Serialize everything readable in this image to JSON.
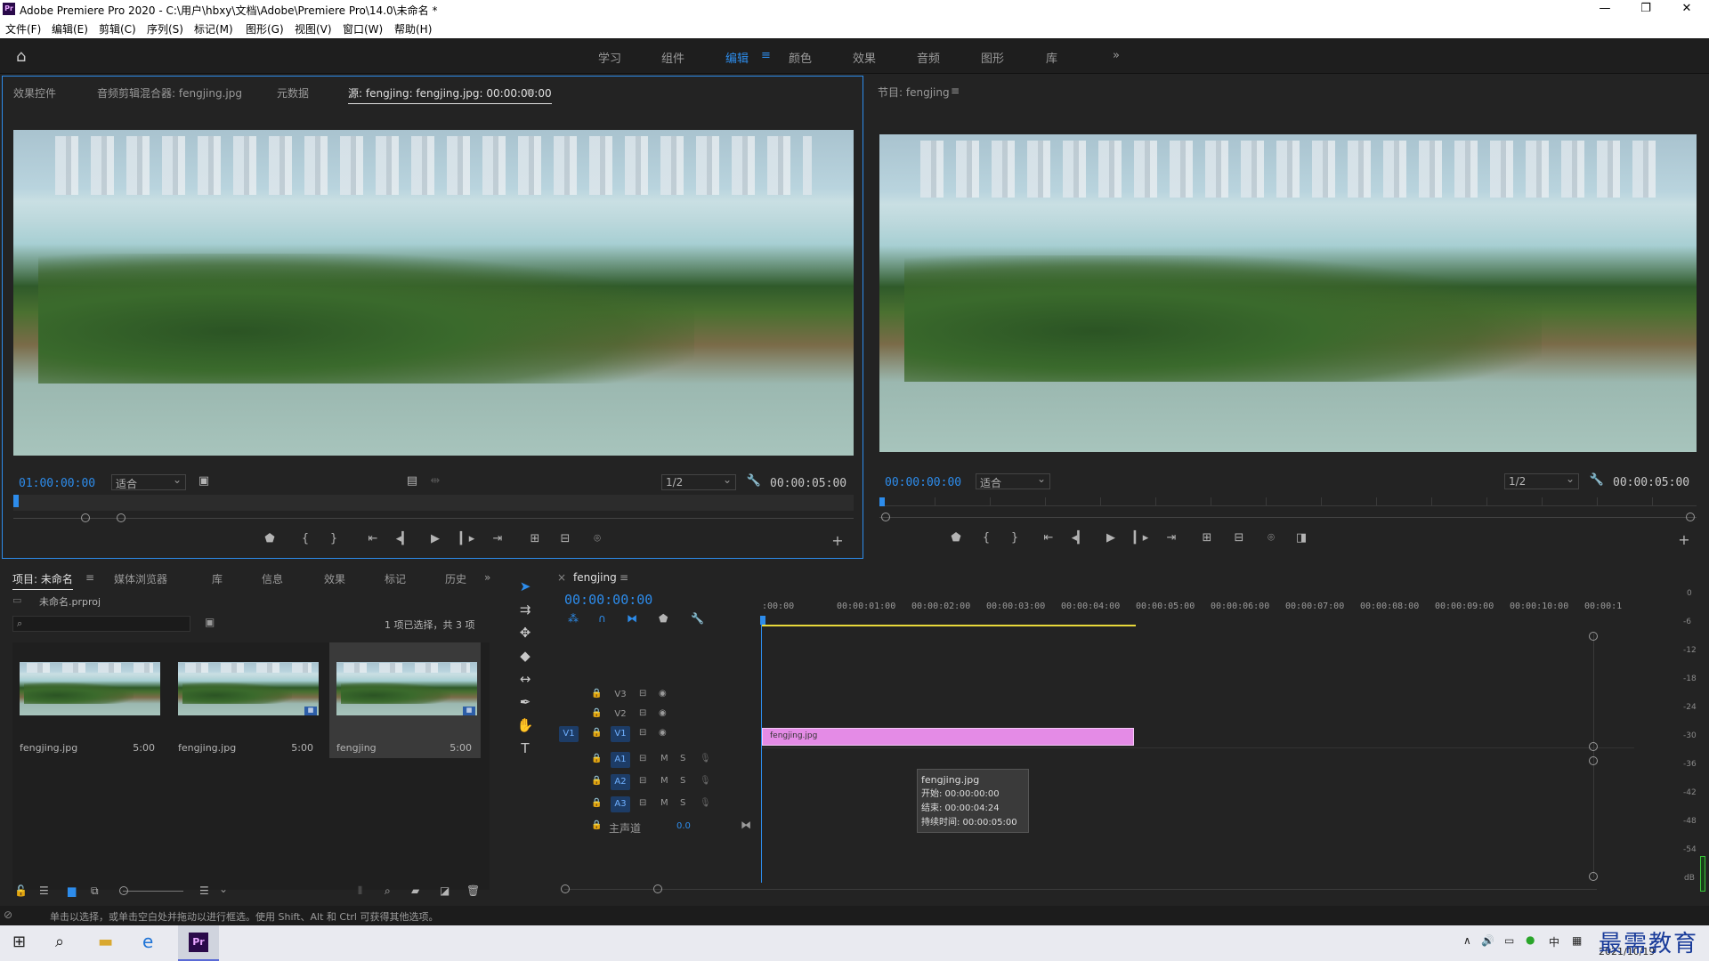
{
  "app": {
    "title": "Adobe Premiere Pro 2020 - C:\\用户\\hbxy\\文档\\Adobe\\Premiere Pro\\14.0\\未命名 *",
    "logo": "Pr"
  },
  "window_controls": {
    "minimize": "—",
    "maximize": "❐",
    "close": "✕"
  },
  "menu": [
    "文件(F)",
    "编辑(E)",
    "剪辑(C)",
    "序列(S)",
    "标记(M)",
    "图形(G)",
    "视图(V)",
    "窗口(W)",
    "帮助(H)"
  ],
  "workspaces": {
    "items": [
      "学习",
      "组件",
      "编辑",
      "颜色",
      "效果",
      "音频",
      "图形",
      "库"
    ],
    "active": "编辑",
    "more": "»"
  },
  "source_panel": {
    "tabs": [
      "效果控件",
      "音频剪辑混合器: fengjing.jpg",
      "元数据",
      "源: fengjing: fengjing.jpg: 00:00:00:00"
    ],
    "active_tab_index": 3,
    "timecode": "01:00:00:00",
    "zoom": "适合",
    "resolution": "1/2",
    "duration": "00:00:05:00",
    "add": "+"
  },
  "program_panel": {
    "tab": "节目: fengjing",
    "timecode": "00:00:00:00",
    "zoom": "适合",
    "resolution": "1/2",
    "duration": "00:00:05:00",
    "add": "+"
  },
  "project_panel": {
    "tabs": [
      "项目: 未命名",
      "媒体浏览器",
      "库",
      "信息",
      "效果",
      "标记",
      "历史"
    ],
    "more": "»",
    "project_file": "未命名.prproj",
    "search_placeholder": "",
    "selection_info": "1 项已选择，共 3 项",
    "items": [
      {
        "name": "fengjing.jpg",
        "duration": "5:00"
      },
      {
        "name": "fengjing.jpg",
        "duration": "5:00"
      },
      {
        "name": "fengjing",
        "duration": "5:00"
      }
    ]
  },
  "timeline": {
    "sequence_tab": "fengjing",
    "timecode": "00:00:00:00",
    "ruler": [
      ":00:00",
      "00:00:01:00",
      "00:00:02:00",
      "00:00:03:00",
      "00:00:04:00",
      "00:00:05:00",
      "00:00:06:00",
      "00:00:07:00",
      "00:00:08:00",
      "00:00:09:00",
      "00:00:10:00",
      "00:00:1"
    ],
    "video_tracks": [
      {
        "name": "V3",
        "target": ""
      },
      {
        "name": "V2",
        "target": ""
      },
      {
        "name": "V1",
        "target": "V1"
      }
    ],
    "audio_tracks": [
      {
        "name": "A1",
        "mute": "M",
        "solo": "S"
      },
      {
        "name": "A2",
        "mute": "M",
        "solo": "S"
      },
      {
        "name": "A3",
        "mute": "M",
        "solo": "S"
      }
    ],
    "master": {
      "label": "主声道",
      "value": "0.0"
    },
    "clip": {
      "name": "fengjing.jpg"
    },
    "tooltip": {
      "title": "fengjing.jpg",
      "start": "开始: 00:00:00:00",
      "end": "结束: 00:00:04:24",
      "duration": "持续时间: 00:00:05:00"
    }
  },
  "audio_meter": {
    "labels": [
      "0",
      "-6",
      "-12",
      "-18",
      "-24",
      "-30",
      "-36",
      "-42",
      "-48",
      "-54",
      "dB"
    ]
  },
  "status_bar": "单击以选择，或单击空白处并拖动以进行框选。使用 Shift、Alt 和 Ctrl 可获得其他选项。",
  "taskbar": {
    "ime": "中",
    "date": "2021/10/19",
    "watermark": "最需教育"
  },
  "colors": {
    "accent": "#2d8ceb",
    "clip": "#e48be6",
    "bg": "#232323"
  }
}
